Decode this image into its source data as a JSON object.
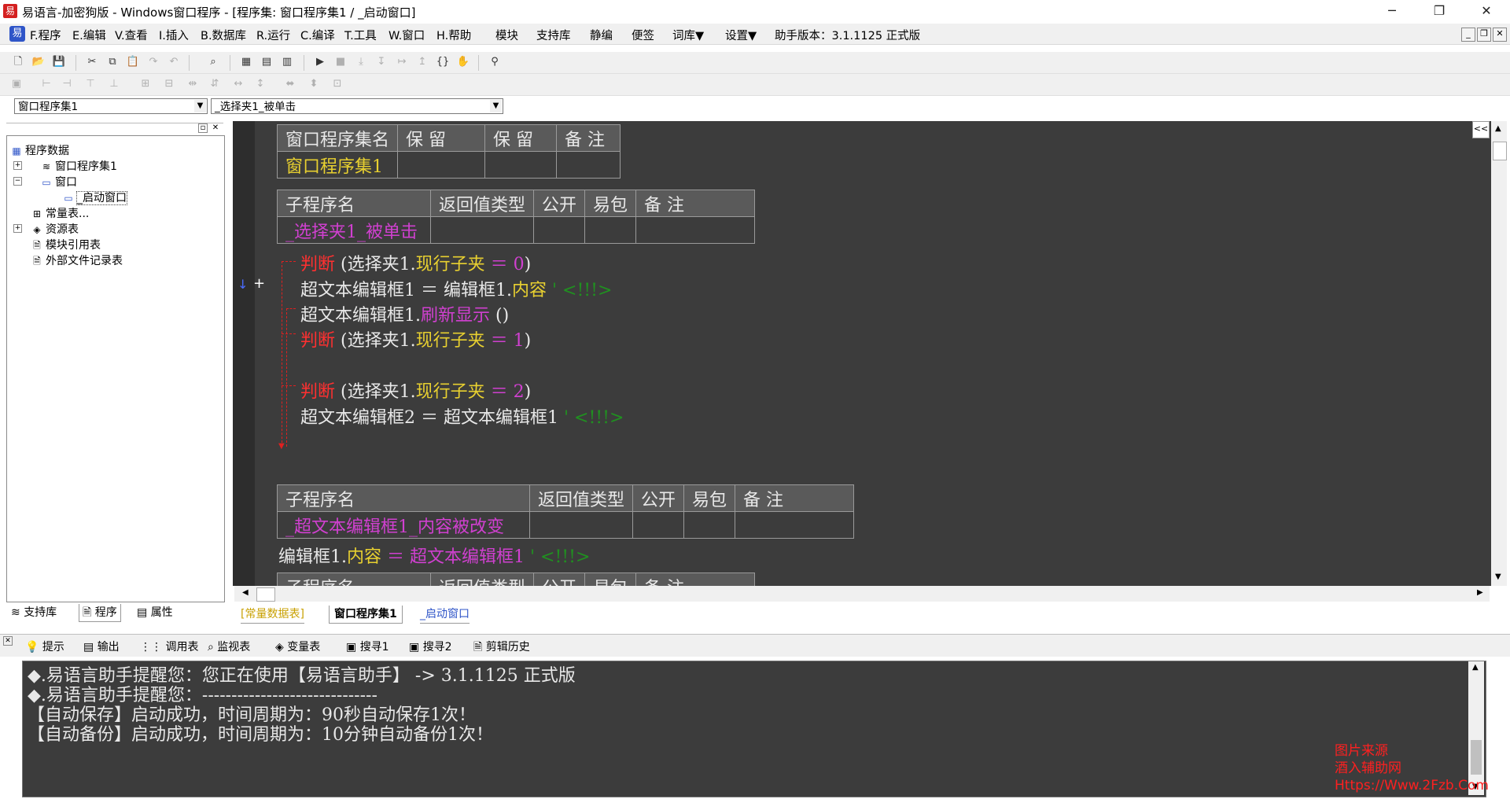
{
  "window": {
    "title": "易语言-加密狗版 - Windows窗口程序 - [程序集: 窗口程序集1 / _启动窗口]",
    "minimize": "─",
    "restore": "❐",
    "close": "✕"
  },
  "menu": {
    "items": [
      "F.程序",
      "E.编辑",
      "V.查看",
      "I.插入",
      "B.数据库",
      "R.运行",
      "C.编译",
      "T.工具",
      "W.窗口",
      "H.帮助",
      "模块",
      "支持库",
      "静编",
      "便签",
      "词库▼",
      "设置▼",
      "助手版本：3.1.1125 正式版"
    ]
  },
  "combos": {
    "left": "窗口程序集1",
    "right": "_选择夹1_被单击"
  },
  "tree": {
    "root": "程序数据",
    "items": [
      "窗口程序集1",
      "窗口",
      "_启动窗口",
      "常量表...",
      "资源表",
      "模块引用表",
      "外部文件记录表"
    ]
  },
  "left_tabs": [
    "支持库",
    "程序",
    "属性"
  ],
  "editor": {
    "assembly_table": {
      "headers": [
        "窗口程序集名",
        "保 留",
        "保 留",
        "备 注"
      ],
      "row": [
        "窗口程序集1",
        "",
        "",
        ""
      ]
    },
    "sub1_table": {
      "headers": [
        "子程序名",
        "返回值类型",
        "公开",
        "易包",
        "备 注"
      ],
      "row": [
        "_选择夹1_被单击",
        "",
        "",
        "",
        ""
      ]
    },
    "code1": [
      {
        "a": "判断",
        "b": " (选择夹1.",
        "c": "现行子夹",
        "d": " ＝ ",
        "e": "0",
        "f": ")",
        "g": ""
      },
      {
        "a": "",
        "b": "超文本编辑框1 ＝ 编辑框1.",
        "c": "内容",
        "d": "",
        "e": "",
        "f": "",
        "g": "  ' <!!!>"
      },
      {
        "a": "",
        "b": "超文本编辑框1.",
        "c": "",
        "d": "",
        "e": "刷新显示",
        "f": " ()",
        "g": ""
      },
      {
        "a": "判断",
        "b": " (选择夹1.",
        "c": "现行子夹",
        "d": " ＝ ",
        "e": "1",
        "f": ")",
        "g": ""
      },
      {
        "a": "判断",
        "b": " (选择夹1.",
        "c": "现行子夹",
        "d": " ＝ ",
        "e": "2",
        "f": ")",
        "g": ""
      },
      {
        "a": "",
        "b": "超文本编辑框2 ＝ 超文本编辑框1",
        "c": "",
        "d": "",
        "e": "",
        "f": "",
        "g": "  ' <!!!>"
      }
    ],
    "sub2_table": {
      "headers": [
        "子程序名",
        "返回值类型",
        "公开",
        "易包",
        "备 注"
      ],
      "row": [
        "_超文本编辑框1_内容被改变",
        "",
        "",
        "",
        ""
      ]
    },
    "code2": {
      "b": "编辑框1.",
      "c": "内容",
      "d": " ＝ 超文本编辑框1",
      "g": "  ' <!!!>"
    },
    "sub3_table": {
      "headers": [
        "子程序名",
        "返回值类型",
        "公开",
        "易包",
        "备 注"
      ]
    },
    "gutter_markers": {
      "arrow": "↓",
      "plus": "+"
    },
    "collapse_button": "<<"
  },
  "doc_tabs": [
    "[常量数据表]",
    "窗口程序集1",
    "_启动窗口"
  ],
  "bottom_tabs": [
    "提示",
    "输出",
    "调用表",
    "监视表",
    "变量表",
    "搜寻1",
    "搜寻2",
    "剪辑历史"
  ],
  "output": [
    "◆.易语言助手提醒您：您正在使用【易语言助手】 -> 3.1.1125 正式版",
    "◆.易语言助手提醒您：------------------------------",
    "【自动保存】启动成功，时间周期为：90秒自动保存1次！",
    "【自动备份】启动成功，时间周期为：10分钟自动备份1次！"
  ],
  "watermark": [
    "图片来源",
    "酒入辅助网",
    "Https://Www.2Fzb.Com"
  ]
}
